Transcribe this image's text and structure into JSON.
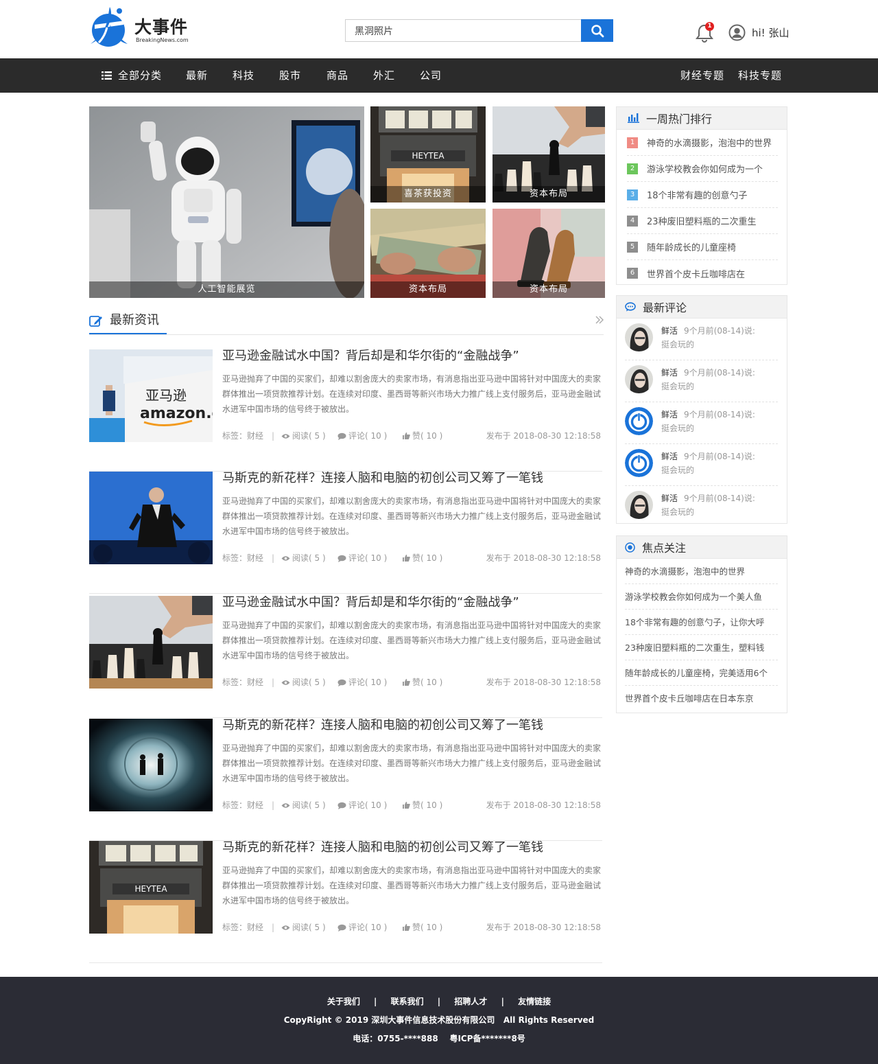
{
  "brand": {
    "name": "大事件",
    "subtitle": "BreakingNews.com",
    "accent": "#1a73d9"
  },
  "header": {
    "search_value": "黑洞照片",
    "search_icon": "search-icon",
    "notification_count": "1",
    "user_greeting": "hi! 张山"
  },
  "nav": {
    "all_label": "全部分类",
    "items": [
      "最新",
      "科技",
      "股市",
      "商品",
      "外汇",
      "公司"
    ],
    "right_items": [
      "财经专题",
      "科技专题"
    ]
  },
  "hero": {
    "tiles": [
      {
        "caption": "人工智能展览",
        "image": "asimo-robot"
      },
      {
        "caption": "喜茶获投资",
        "image": "heytea-storefront"
      },
      {
        "caption": "资本布局",
        "image": "chess-hand"
      },
      {
        "caption": "资本布局",
        "image": "money-counting"
      },
      {
        "caption": "资本布局",
        "image": "chess-knights-on-money"
      }
    ]
  },
  "news": {
    "section_title": "最新资讯",
    "more_icon": "double-chevron-right-icon",
    "articles": [
      {
        "title": "亚马逊金融试水中国？背后却是和华尔街的“金融战争”",
        "summary": "亚马逊抛弃了中国的买家们，却难以割舍庞大的卖家市场，有消息指出亚马逊中国将针对中国庞大的卖家群体推出一项贷款推荐计划。在连续对印度、墨西哥等新兴市场大力推广线上支付服务后，亚马逊金融试水进军中国市场的信号终于被放出。",
        "tag": "标签：财经",
        "reads": "阅读( 5 )",
        "comments": "评论( 10 )",
        "likes": "赞( 10 )",
        "date": "发布于 2018-08-30 12:18:58",
        "image": "amazon-booth"
      },
      {
        "title": "马斯克的新花样？连接人脑和电脑的初创公司又筹了一笔钱",
        "summary": "亚马逊抛弃了中国的买家们，却难以割舍庞大的卖家市场，有消息指出亚马逊中国将针对中国庞大的卖家群体推出一项贷款推荐计划。在连续对印度、墨西哥等新兴市场大力推广线上支付服务后，亚马逊金融试水进军中国市场的信号终于被放出。",
        "tag": "标签：财经",
        "reads": "阅读( 5 )",
        "comments": "评论( 10 )",
        "likes": "赞( 10 )",
        "date": "发布于 2018-08-30 12:18:58",
        "image": "speaker-on-stage"
      },
      {
        "title": "亚马逊金融试水中国？背后却是和华尔街的“金融战争”",
        "summary": "亚马逊抛弃了中国的买家们，却难以割舍庞大的卖家市场，有消息指出亚马逊中国将针对中国庞大的卖家群体推出一项贷款推荐计划。在连续对印度、墨西哥等新兴市场大力推广线上支付服务后，亚马逊金融试水进军中国市场的信号终于被放出。",
        "tag": "标签：财经",
        "reads": "阅读( 5 )",
        "comments": "评论( 10 )",
        "likes": "赞( 10 )",
        "date": "发布于 2018-08-30 12:18:58",
        "image": "chess-hand"
      },
      {
        "title": "马斯克的新花样？连接人脑和电脑的初创公司又筹了一笔钱",
        "summary": "亚马逊抛弃了中国的买家们，却难以割舍庞大的卖家市场，有消息指出亚马逊中国将针对中国庞大的卖家群体推出一项贷款推荐计划。在连续对印度、墨西哥等新兴市场大力推广线上支付服务后，亚马逊金融试水进军中国市场的信号终于被放出。",
        "tag": "标签：财经",
        "reads": "阅读( 5 )",
        "comments": "评论( 10 )",
        "likes": "赞( 10 )",
        "date": "发布于 2018-08-30 12:18:58",
        "image": "tunnel-silhouettes"
      },
      {
        "title": "马斯克的新花样？连接人脑和电脑的初创公司又筹了一笔钱",
        "summary": "亚马逊抛弃了中国的买家们，却难以割舍庞大的卖家市场，有消息指出亚马逊中国将针对中国庞大的卖家群体推出一项贷款推荐计划。在连续对印度、墨西哥等新兴市场大力推广线上支付服务后，亚马逊金融试水进军中国市场的信号终于被放出。",
        "tag": "标签：财经",
        "reads": "阅读( 5 )",
        "comments": "评论( 10 )",
        "likes": "赞( 10 )",
        "date": "发布于 2018-08-30 12:18:58",
        "image": "heytea-storefront"
      }
    ]
  },
  "sidebar": {
    "hot": {
      "title": "一周热门排行",
      "icon": "bar-chart-icon",
      "items": [
        {
          "rank": "1",
          "text": "神奇的水滴摄影，泡泡中的世界",
          "color": "#f08b84"
        },
        {
          "rank": "2",
          "text": "游泳学校教会你如何成为一个",
          "color": "#6cc65c"
        },
        {
          "rank": "3",
          "text": "18个非常有趣的创意勺子",
          "color": "#5aaee8"
        },
        {
          "rank": "4",
          "text": "23种废旧塑料瓶的二次重生",
          "color": "#8e8e8e"
        },
        {
          "rank": "5",
          "text": "随年龄成长的儿童座椅",
          "color": "#8e8e8e"
        },
        {
          "rank": "6",
          "text": "世界首个皮卡丘咖啡店在",
          "color": "#8e8e8e"
        }
      ]
    },
    "comments": {
      "title": "最新评论",
      "icon": "chat-bubble-icon",
      "items": [
        {
          "name": "鲜活",
          "time": "9个月前(08-14)说:",
          "text": "挺会玩的",
          "avatar": "portrait-avatar"
        },
        {
          "name": "鲜活",
          "time": "9个月前(08-14)说:",
          "text": "挺会玩的",
          "avatar": "portrait-avatar"
        },
        {
          "name": "鲜活",
          "time": "9个月前(08-14)说:",
          "text": "挺会玩的",
          "avatar": "power-ring-avatar"
        },
        {
          "name": "鲜活",
          "time": "9个月前(08-14)说:",
          "text": "挺会玩的",
          "avatar": "power-ring-avatar"
        },
        {
          "name": "鲜活",
          "time": "9个月前(08-14)说:",
          "text": "挺会玩的",
          "avatar": "portrait-avatar"
        }
      ]
    },
    "focus": {
      "title": "焦点关注",
      "icon": "target-icon",
      "items": [
        "神奇的水滴摄影，泡泡中的世界",
        "游泳学校教会你如何成为一个美人鱼",
        "18个非常有趣的创意勺子，让你大呼",
        "23种废旧塑料瓶的二次重生，塑料钱",
        "随年龄成长的儿童座椅，完美适用6个",
        "世界首个皮卡丘咖啡店在日本东京"
      ]
    }
  },
  "footer": {
    "links": [
      "关于我们",
      "联系我们",
      "招聘人才",
      "友情链接"
    ],
    "separator": "|",
    "copyright": "CopyRight © 2019 深圳大事件信息技术股份有限公司   All Rights Reserved",
    "contact": "电话：0755-****888    粤ICP备*******8号"
  }
}
